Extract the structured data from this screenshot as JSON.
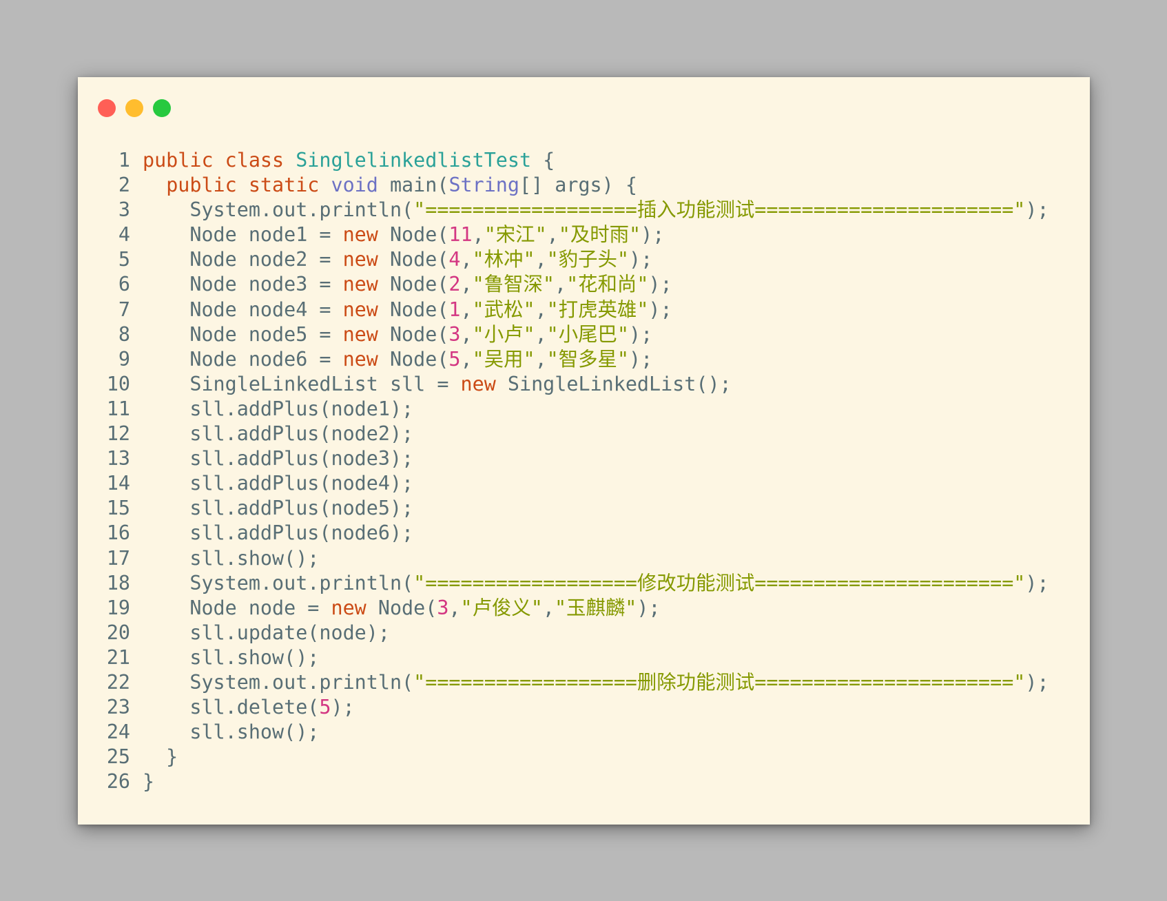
{
  "window": {
    "controls": [
      "close",
      "minimize",
      "maximize"
    ],
    "control_colors": {
      "close": "#ff5f56",
      "minimize": "#ffbd2e",
      "maximize": "#27c93f"
    }
  },
  "theme": {
    "page_bg": "#b9b9b9",
    "editor_bg": "#fdf6e3",
    "keyword": "#cb4b16",
    "type": "#6c71c4",
    "class_name": "#2aa198",
    "string": "#859900",
    "number": "#d33682",
    "plain": "#657b83"
  },
  "code": {
    "lines": [
      {
        "n": "1",
        "tokens": [
          [
            "kw",
            "public"
          ],
          [
            "p",
            " "
          ],
          [
            "kw",
            "class"
          ],
          [
            "p",
            " "
          ],
          [
            "cls",
            "SinglelinkedlistTest"
          ],
          [
            "p",
            " {"
          ]
        ]
      },
      {
        "n": "2",
        "tokens": [
          [
            "p",
            "  "
          ],
          [
            "kw",
            "public"
          ],
          [
            "p",
            " "
          ],
          [
            "kw",
            "static"
          ],
          [
            "p",
            " "
          ],
          [
            "ty",
            "void"
          ],
          [
            "p",
            " main("
          ],
          [
            "ty",
            "String"
          ],
          [
            "p",
            "[] args) {"
          ]
        ]
      },
      {
        "n": "3",
        "tokens": [
          [
            "p",
            "    System.out.println("
          ],
          [
            "str",
            "\"==================插入功能测试======================\""
          ],
          [
            "p",
            ");"
          ]
        ]
      },
      {
        "n": "4",
        "tokens": [
          [
            "p",
            "    Node node1 = "
          ],
          [
            "kw",
            "new"
          ],
          [
            "p",
            " Node("
          ],
          [
            "num",
            "11"
          ],
          [
            "p",
            ","
          ],
          [
            "str",
            "\"宋江\""
          ],
          [
            "p",
            ","
          ],
          [
            "str",
            "\"及时雨\""
          ],
          [
            "p",
            ");"
          ]
        ]
      },
      {
        "n": "5",
        "tokens": [
          [
            "p",
            "    Node node2 = "
          ],
          [
            "kw",
            "new"
          ],
          [
            "p",
            " Node("
          ],
          [
            "num",
            "4"
          ],
          [
            "p",
            ","
          ],
          [
            "str",
            "\"林冲\""
          ],
          [
            "p",
            ","
          ],
          [
            "str",
            "\"豹子头\""
          ],
          [
            "p",
            ");"
          ]
        ]
      },
      {
        "n": "6",
        "tokens": [
          [
            "p",
            "    Node node3 = "
          ],
          [
            "kw",
            "new"
          ],
          [
            "p",
            " Node("
          ],
          [
            "num",
            "2"
          ],
          [
            "p",
            ","
          ],
          [
            "str",
            "\"鲁智深\""
          ],
          [
            "p",
            ","
          ],
          [
            "str",
            "\"花和尚\""
          ],
          [
            "p",
            ");"
          ]
        ]
      },
      {
        "n": "7",
        "tokens": [
          [
            "p",
            "    Node node4 = "
          ],
          [
            "kw",
            "new"
          ],
          [
            "p",
            " Node("
          ],
          [
            "num",
            "1"
          ],
          [
            "p",
            ","
          ],
          [
            "str",
            "\"武松\""
          ],
          [
            "p",
            ","
          ],
          [
            "str",
            "\"打虎英雄\""
          ],
          [
            "p",
            ");"
          ]
        ]
      },
      {
        "n": "8",
        "tokens": [
          [
            "p",
            "    Node node5 = "
          ],
          [
            "kw",
            "new"
          ],
          [
            "p",
            " Node("
          ],
          [
            "num",
            "3"
          ],
          [
            "p",
            ","
          ],
          [
            "str",
            "\"小卢\""
          ],
          [
            "p",
            ","
          ],
          [
            "str",
            "\"小尾巴\""
          ],
          [
            "p",
            ");"
          ]
        ]
      },
      {
        "n": "9",
        "tokens": [
          [
            "p",
            "    Node node6 = "
          ],
          [
            "kw",
            "new"
          ],
          [
            "p",
            " Node("
          ],
          [
            "num",
            "5"
          ],
          [
            "p",
            ","
          ],
          [
            "str",
            "\"吴用\""
          ],
          [
            "p",
            ","
          ],
          [
            "str",
            "\"智多星\""
          ],
          [
            "p",
            ");"
          ]
        ]
      },
      {
        "n": "10",
        "tokens": [
          [
            "p",
            "    SingleLinkedList sll = "
          ],
          [
            "kw",
            "new"
          ],
          [
            "p",
            " SingleLinkedList();"
          ]
        ]
      },
      {
        "n": "11",
        "tokens": [
          [
            "p",
            "    sll.addPlus(node1);"
          ]
        ]
      },
      {
        "n": "12",
        "tokens": [
          [
            "p",
            "    sll.addPlus(node2);"
          ]
        ]
      },
      {
        "n": "13",
        "tokens": [
          [
            "p",
            "    sll.addPlus(node3);"
          ]
        ]
      },
      {
        "n": "14",
        "tokens": [
          [
            "p",
            "    sll.addPlus(node4);"
          ]
        ]
      },
      {
        "n": "15",
        "tokens": [
          [
            "p",
            "    sll.addPlus(node5);"
          ]
        ]
      },
      {
        "n": "16",
        "tokens": [
          [
            "p",
            "    sll.addPlus(node6);"
          ]
        ]
      },
      {
        "n": "17",
        "tokens": [
          [
            "p",
            "    sll.show();"
          ]
        ]
      },
      {
        "n": "18",
        "tokens": [
          [
            "p",
            "    System.out.println("
          ],
          [
            "str",
            "\"==================修改功能测试======================\""
          ],
          [
            "p",
            ");"
          ]
        ]
      },
      {
        "n": "19",
        "tokens": [
          [
            "p",
            "    Node node = "
          ],
          [
            "kw",
            "new"
          ],
          [
            "p",
            " Node("
          ],
          [
            "num",
            "3"
          ],
          [
            "p",
            ","
          ],
          [
            "str",
            "\"卢俊义\""
          ],
          [
            "p",
            ","
          ],
          [
            "str",
            "\"玉麒麟\""
          ],
          [
            "p",
            ");"
          ]
        ]
      },
      {
        "n": "20",
        "tokens": [
          [
            "p",
            "    sll.update(node);"
          ]
        ]
      },
      {
        "n": "21",
        "tokens": [
          [
            "p",
            "    sll.show();"
          ]
        ]
      },
      {
        "n": "22",
        "tokens": [
          [
            "p",
            "    System.out.println("
          ],
          [
            "str",
            "\"==================删除功能测试======================\""
          ],
          [
            "p",
            ");"
          ]
        ]
      },
      {
        "n": "23",
        "tokens": [
          [
            "p",
            "    sll.delete("
          ],
          [
            "num",
            "5"
          ],
          [
            "p",
            ");"
          ]
        ]
      },
      {
        "n": "24",
        "tokens": [
          [
            "p",
            "    sll.show();"
          ]
        ]
      },
      {
        "n": "25",
        "tokens": [
          [
            "p",
            "  }"
          ]
        ]
      },
      {
        "n": "26",
        "tokens": [
          [
            "p",
            "}"
          ]
        ]
      }
    ]
  }
}
